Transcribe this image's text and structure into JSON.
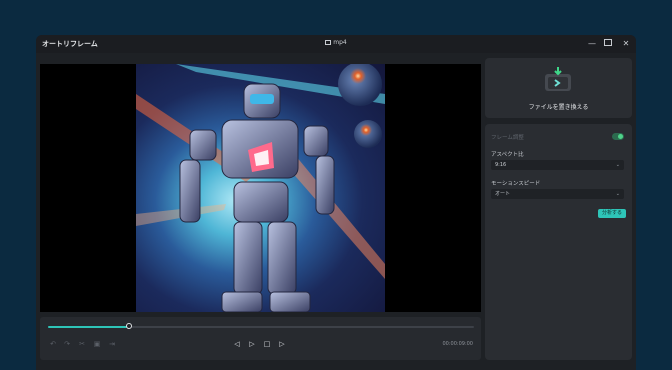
{
  "window": {
    "app_title": "オートリフレーム",
    "file_name": "mp4",
    "controls": {
      "minimize": "—",
      "close": "✕"
    }
  },
  "player": {
    "timecode": "00:00:09:00",
    "progress": 0.19,
    "icons": [
      "undo-icon",
      "redo-icon",
      "split-icon",
      "delete-icon",
      "trim-icon",
      "previous-frame-icon",
      "play-icon",
      "stop-icon",
      "next-frame-icon"
    ]
  },
  "side_panel": {
    "replace_file_label": "ファイルを置き換える",
    "frame_adjust_title": "フレーム調整",
    "aspect_ratio_label": "アスペクト比",
    "aspect_ratio_value": "9:16",
    "motion_speed_label": "モーションスピード",
    "motion_speed_value": "オート",
    "analyze_button": "分析する",
    "toggle_on": true
  },
  "colors": {
    "background": "#0b2a40",
    "accent": "#2ec5b8",
    "window": "#1e2125",
    "panel": "#2a2d32"
  }
}
